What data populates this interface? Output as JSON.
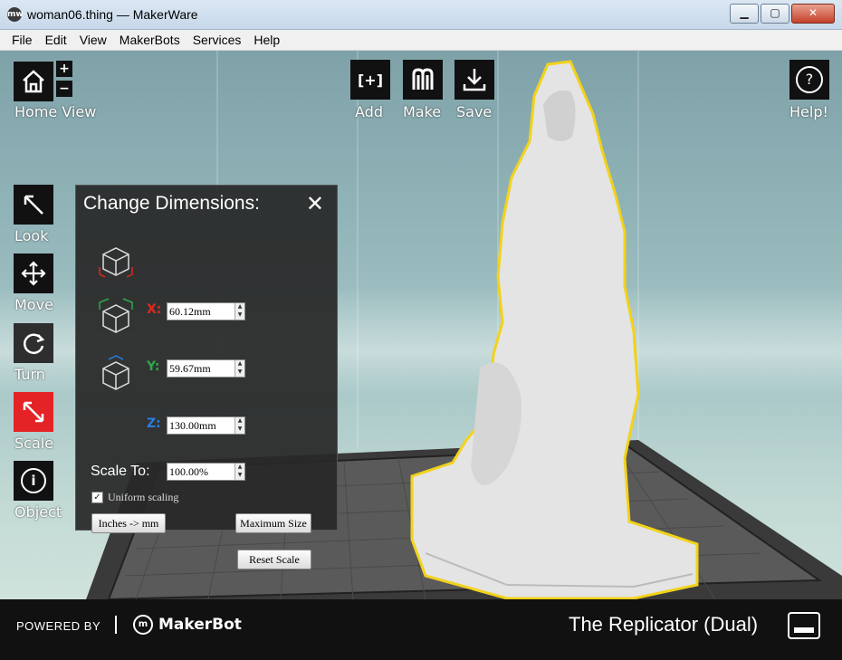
{
  "window": {
    "title": "woman06.thing — MakerWare",
    "app_icon_text": "mw"
  },
  "menu": [
    "File",
    "Edit",
    "View",
    "MakerBots",
    "Services",
    "Help"
  ],
  "toolbar": {
    "home_label": "Home View",
    "add_label": "Add",
    "make_label": "Make",
    "save_label": "Save",
    "help_label": "Help!",
    "add_icon_text": "[+]",
    "help_icon_text": "?",
    "zoom_in": "+",
    "zoom_out": "−"
  },
  "side_tools": {
    "look": "Look",
    "move": "Move",
    "turn": "Turn",
    "scale": "Scale",
    "object": "Object"
  },
  "dimensions_panel": {
    "title": "Change Dimensions:",
    "close": "✕",
    "x_label": "X:",
    "x_value": "60.12mm",
    "x_color": "#e0281e",
    "y_label": "Y:",
    "y_value": "59.67mm",
    "y_color": "#2ea84a",
    "z_label": "Z:",
    "z_value": "130.00mm",
    "z_color": "#2a7de1",
    "scale_label": "Scale To:",
    "scale_value": "100.00%",
    "uniform_label": "Uniform scaling",
    "uniform_checked": "✓",
    "inches_button": "Inches -> mm",
    "max_size_button": "Maximum Size",
    "reset_button": "Reset Scale"
  },
  "footer": {
    "powered_by": "POWERED BY",
    "brand_icon": "m",
    "brand": "MakerBot",
    "printer": "The Replicator (Dual)"
  },
  "colors": {
    "selected_outline": "#f2d21b",
    "scale_active": "#e42326",
    "panel_bg": "#282828"
  }
}
